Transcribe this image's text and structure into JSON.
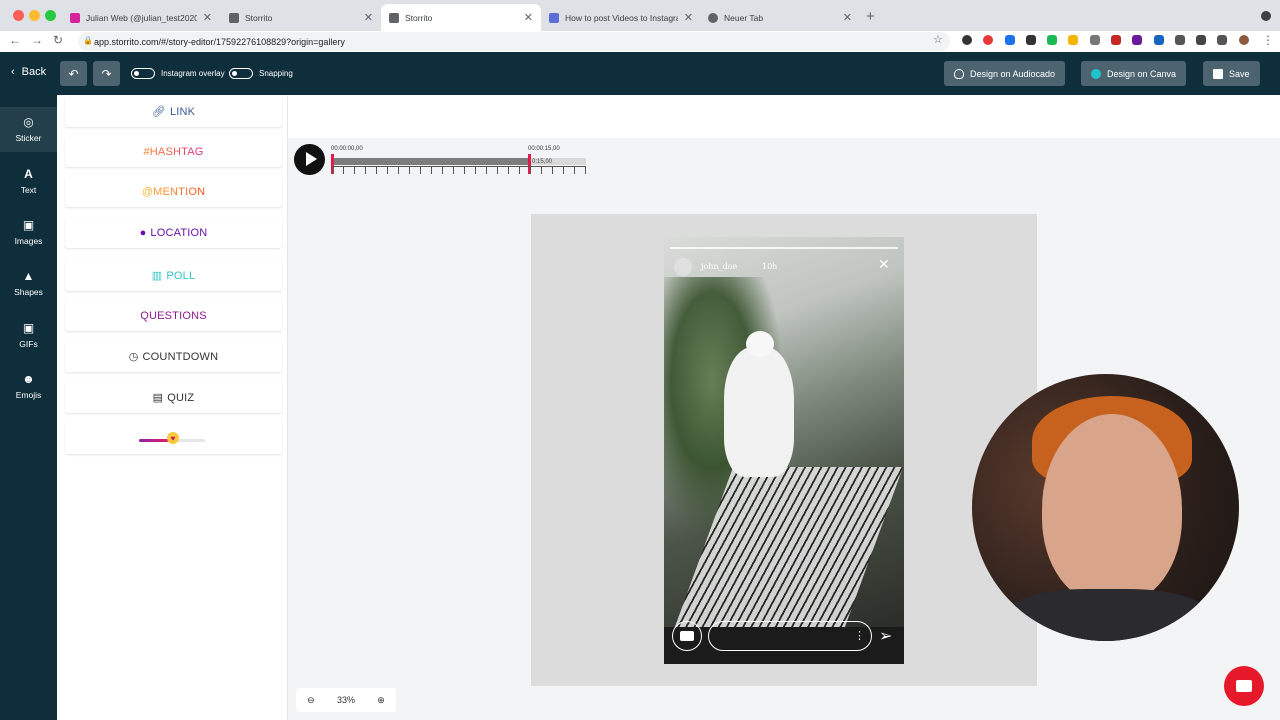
{
  "browser": {
    "tabs": [
      {
        "title": "Julian Web (@julian_test2020)",
        "icon": "instagram-icon",
        "active": false
      },
      {
        "title": "Storrito",
        "icon": "storrito-icon",
        "active": false
      },
      {
        "title": "Storrito",
        "icon": "storrito-icon",
        "active": true
      },
      {
        "title": "How to post Videos to Instagram",
        "icon": "gear-icon",
        "active": false
      },
      {
        "title": "Neuer Tab",
        "icon": "chrome-icon",
        "active": false
      }
    ],
    "url": "app.storrito.com/#/story-editor/17592276108829?origin=gallery"
  },
  "header": {
    "back_label": "Back",
    "overlay_label": "Instagram overlay",
    "snapping_label": "Snapping",
    "audiocado_label": "Design on Audiocado",
    "canva_label": "Design on Canva",
    "save_label": "Save"
  },
  "sidebar": {
    "items": [
      {
        "label": "Sticker",
        "icon": "instagram-icon"
      },
      {
        "label": "Text",
        "icon": "text-icon"
      },
      {
        "label": "Images",
        "icon": "camera-icon"
      },
      {
        "label": "Shapes",
        "icon": "shapes-icon"
      },
      {
        "label": "GIFs",
        "icon": "camera-icon"
      },
      {
        "label": "Emojis",
        "icon": "smiley-icon"
      }
    ]
  },
  "stickers": {
    "link": "LINK",
    "hashtag": "#HASHTAG",
    "mention": "@MENTION",
    "location": "LOCATION",
    "poll": "POLL",
    "questions": "QUESTIONS",
    "countdown": "COUNTDOWN",
    "quiz": "QUIZ",
    "slider_fraction": 0.5
  },
  "timeline": {
    "start": "00:00:00,00",
    "end": "00:00:15,00",
    "marker": "0:15,00"
  },
  "story": {
    "username": "john_doe",
    "time": "10h"
  },
  "zoom": "33%",
  "colors": {
    "header_bg": "#0f2e3b",
    "accent_red": "#e6192b",
    "button_bg": "#4d6470"
  }
}
